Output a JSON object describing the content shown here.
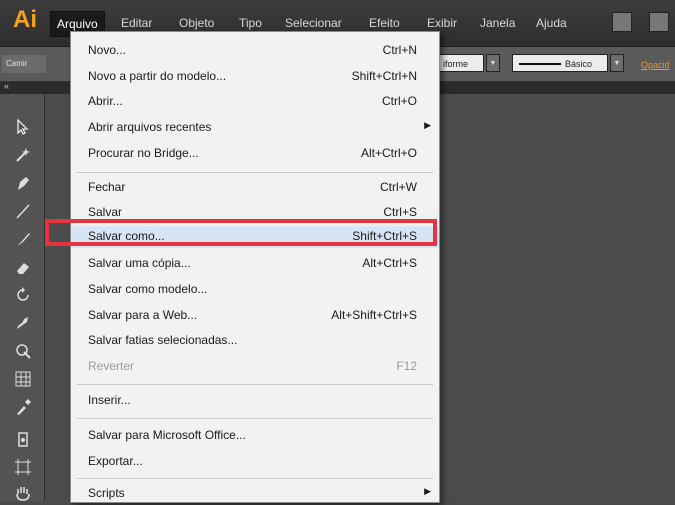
{
  "app": {
    "logo_text": "Ai"
  },
  "menubar": {
    "items": [
      "Arquivo",
      "Editar",
      "Objeto",
      "Tipo",
      "Selecionar",
      "Efeito",
      "Exibir",
      "Janela",
      "Ajuda"
    ],
    "active": "Arquivo"
  },
  "controlbar": {
    "left_label": "Camir",
    "uniform_label": "iforme",
    "stroke_style": "Básico",
    "opacity_label": "Opacid"
  },
  "tabstrip": {
    "collapse_glyph": "«"
  },
  "file_menu": [
    {
      "label": "Novo...",
      "shortcut": "Ctrl+N"
    },
    {
      "label": "Novo a partir do modelo...",
      "shortcut": "Shift+Ctrl+N"
    },
    {
      "label": "Abrir...",
      "shortcut": "Ctrl+O"
    },
    {
      "label": "Abrir arquivos recentes",
      "shortcut": "",
      "submenu": true
    },
    {
      "label": "Procurar no Bridge...",
      "shortcut": "Alt+Ctrl+O"
    },
    {
      "label": "Fechar",
      "shortcut": "Ctrl+W"
    },
    {
      "label": "Salvar",
      "shortcut": "Ctrl+S"
    },
    {
      "label": "Salvar como...",
      "shortcut": "Shift+Ctrl+S",
      "highlighted": true
    },
    {
      "label": "Salvar uma cópia...",
      "shortcut": "Alt+Ctrl+S"
    },
    {
      "label": "Salvar como modelo...",
      "shortcut": ""
    },
    {
      "label": "Salvar para a Web...",
      "shortcut": "Alt+Shift+Ctrl+S"
    },
    {
      "label": "Salvar fatias selecionadas...",
      "shortcut": ""
    },
    {
      "label": "Reverter",
      "shortcut": "F12",
      "disabled": true
    },
    {
      "label": "Inserir...",
      "shortcut": ""
    },
    {
      "label": "Salvar para Microsoft Office...",
      "shortcut": ""
    },
    {
      "label": "Exportar...",
      "shortcut": ""
    },
    {
      "label": "Scripts",
      "shortcut": "",
      "submenu": true
    }
  ],
  "highlight_color": "#e53340",
  "accent_color": "#f7a21b"
}
